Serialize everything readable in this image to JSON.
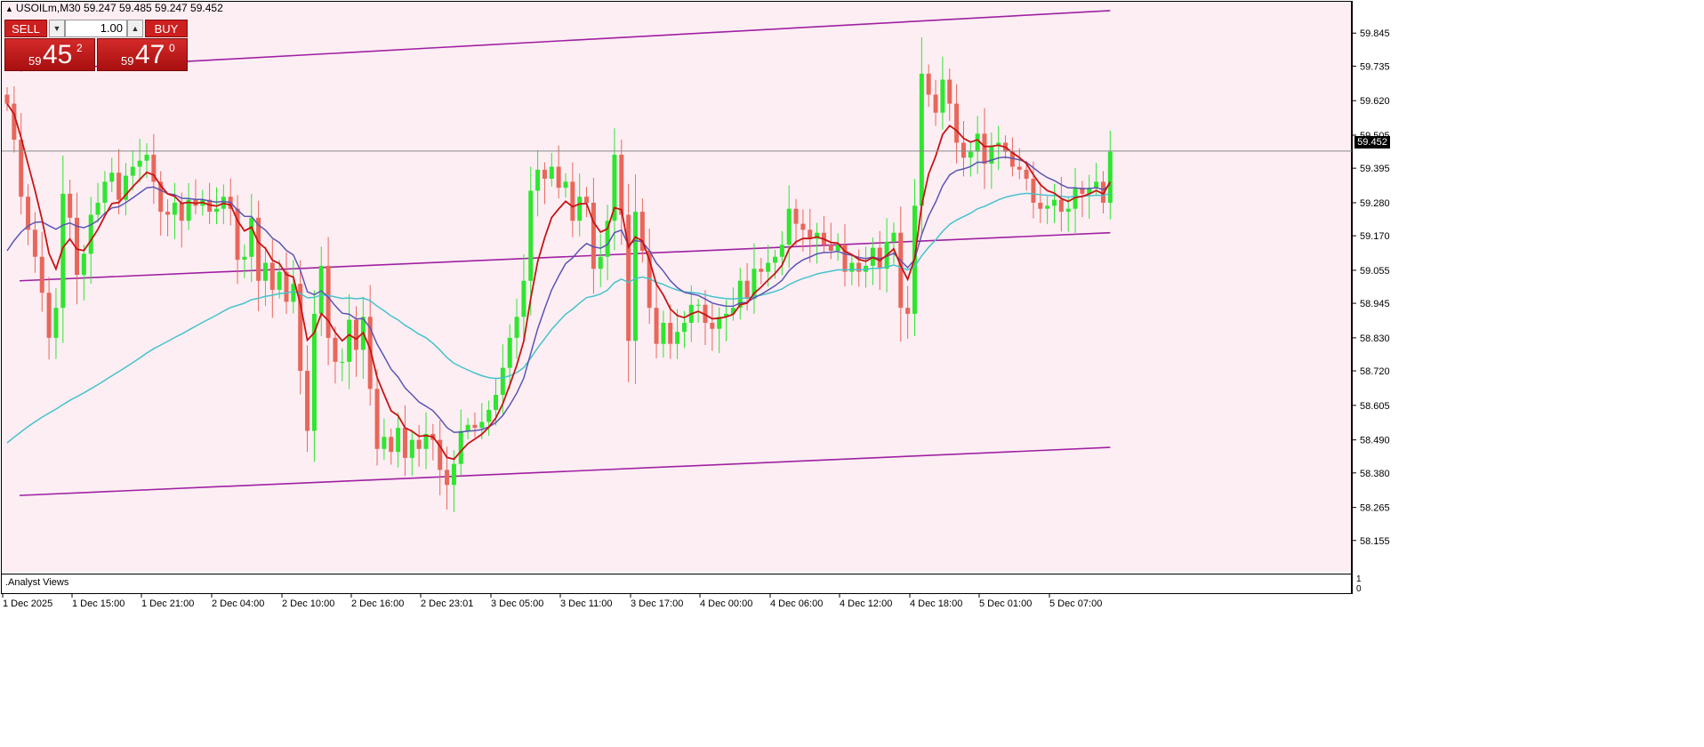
{
  "header": {
    "symbol_line": "USOILm,M30  59.247 59.485 59.247 59.452"
  },
  "trade_panel": {
    "sell_label": "SELL",
    "buy_label": "BUY",
    "lot_value": "1.00",
    "sell_price": {
      "small": "59",
      "big": "45",
      "sup": "2"
    },
    "buy_price": {
      "small": "59",
      "big": "47",
      "sup": "0"
    }
  },
  "indicator_window": {
    "label": ".Analyst Views",
    "scale_top": "1",
    "scale_bottom": "0"
  },
  "colors": {
    "background": "#fdeef4",
    "bull": "#2ee62e",
    "bear": "#e8675a",
    "ma_fast": "#c81414",
    "ma_mid": "#5a55b4",
    "ma_slow": "#46c2cc",
    "channel": "#a020a0",
    "price_line": "#8a8a8a"
  },
  "chart_data": {
    "type": "candlestick",
    "symbol": "USOILm",
    "timeframe": "M30",
    "current_price": 59.452,
    "current_price_label": "59.452",
    "ylim": [
      58.098,
      59.902
    ],
    "y_ticks": [
      "59.845",
      "59.735",
      "59.620",
      "59.505",
      "59.395",
      "59.280",
      "59.170",
      "59.055",
      "58.945",
      "58.830",
      "58.720",
      "58.605",
      "58.490",
      "58.380",
      "58.265",
      "58.155"
    ],
    "x_ticks": [
      "1 Dec 2025",
      "1 Dec 15:00",
      "1 Dec 21:00",
      "2 Dec 04:00",
      "2 Dec 10:00",
      "2 Dec 16:00",
      "2 Dec 23:01",
      "3 Dec 05:00",
      "3 Dec 11:00",
      "3 Dec 17:00",
      "4 Dec 00:00",
      "4 Dec 06:00",
      "4 Dec 12:00",
      "4 Dec 18:00",
      "5 Dec 01:00",
      "5 Dec 07:00"
    ],
    "closes": [
      59.61,
      59.49,
      59.3,
      59.19,
      59.1,
      58.98,
      58.83,
      58.93,
      59.31,
      59.23,
      59.04,
      59.11,
      59.24,
      59.28,
      59.35,
      59.38,
      59.29,
      59.37,
      59.4,
      59.42,
      59.44,
      59.35,
      59.25,
      59.24,
      59.28,
      59.22,
      59.29,
      59.27,
      59.29,
      59.25,
      59.26,
      59.3,
      59.26,
      59.09,
      59.1,
      59.23,
      59.02,
      59.08,
      58.99,
      59.05,
      58.95,
      59.01,
      58.72,
      58.52,
      58.91,
      59.07,
      58.83,
      58.75,
      58.75,
      58.89,
      58.79,
      58.9,
      58.66,
      58.46,
      58.5,
      58.45,
      58.53,
      58.43,
      58.49,
      58.46,
      58.51,
      58.49,
      58.39,
      58.34,
      58.41,
      58.52,
      58.54,
      58.53,
      58.55,
      58.59,
      58.64,
      58.73,
      58.83,
      58.9,
      59.02,
      59.32,
      59.39,
      59.36,
      59.4,
      59.33,
      59.35,
      59.22,
      59.3,
      59.28,
      59.06,
      59.1,
      59.22,
      59.44,
      59.24,
      58.82,
      59.25,
      59.12,
      58.93,
      58.81,
      58.88,
      58.81,
      58.85,
      58.88,
      58.94,
      58.94,
      58.88,
      58.86,
      58.9,
      58.91,
      58.93,
      59.02,
      58.96,
      59.06,
      59.05,
      59.08,
      59.1,
      59.14,
      59.26,
      59.21,
      59.19,
      59.16,
      59.18,
      59.14,
      59.12,
      59.14,
      59.05,
      59.08,
      59.05,
      59.07,
      59.13,
      59.06,
      59.15,
      59.18,
      58.93,
      58.91,
      59.27,
      59.71,
      59.64,
      59.58,
      59.69,
      59.61,
      59.48,
      59.43,
      59.45,
      59.51,
      59.41,
      59.47,
      59.48,
      59.45,
      59.4,
      59.39,
      59.36,
      59.28,
      59.26,
      59.27,
      59.29,
      59.25,
      59.26,
      59.33,
      59.31,
      59.33,
      59.35,
      59.28,
      59.45
    ]
  }
}
